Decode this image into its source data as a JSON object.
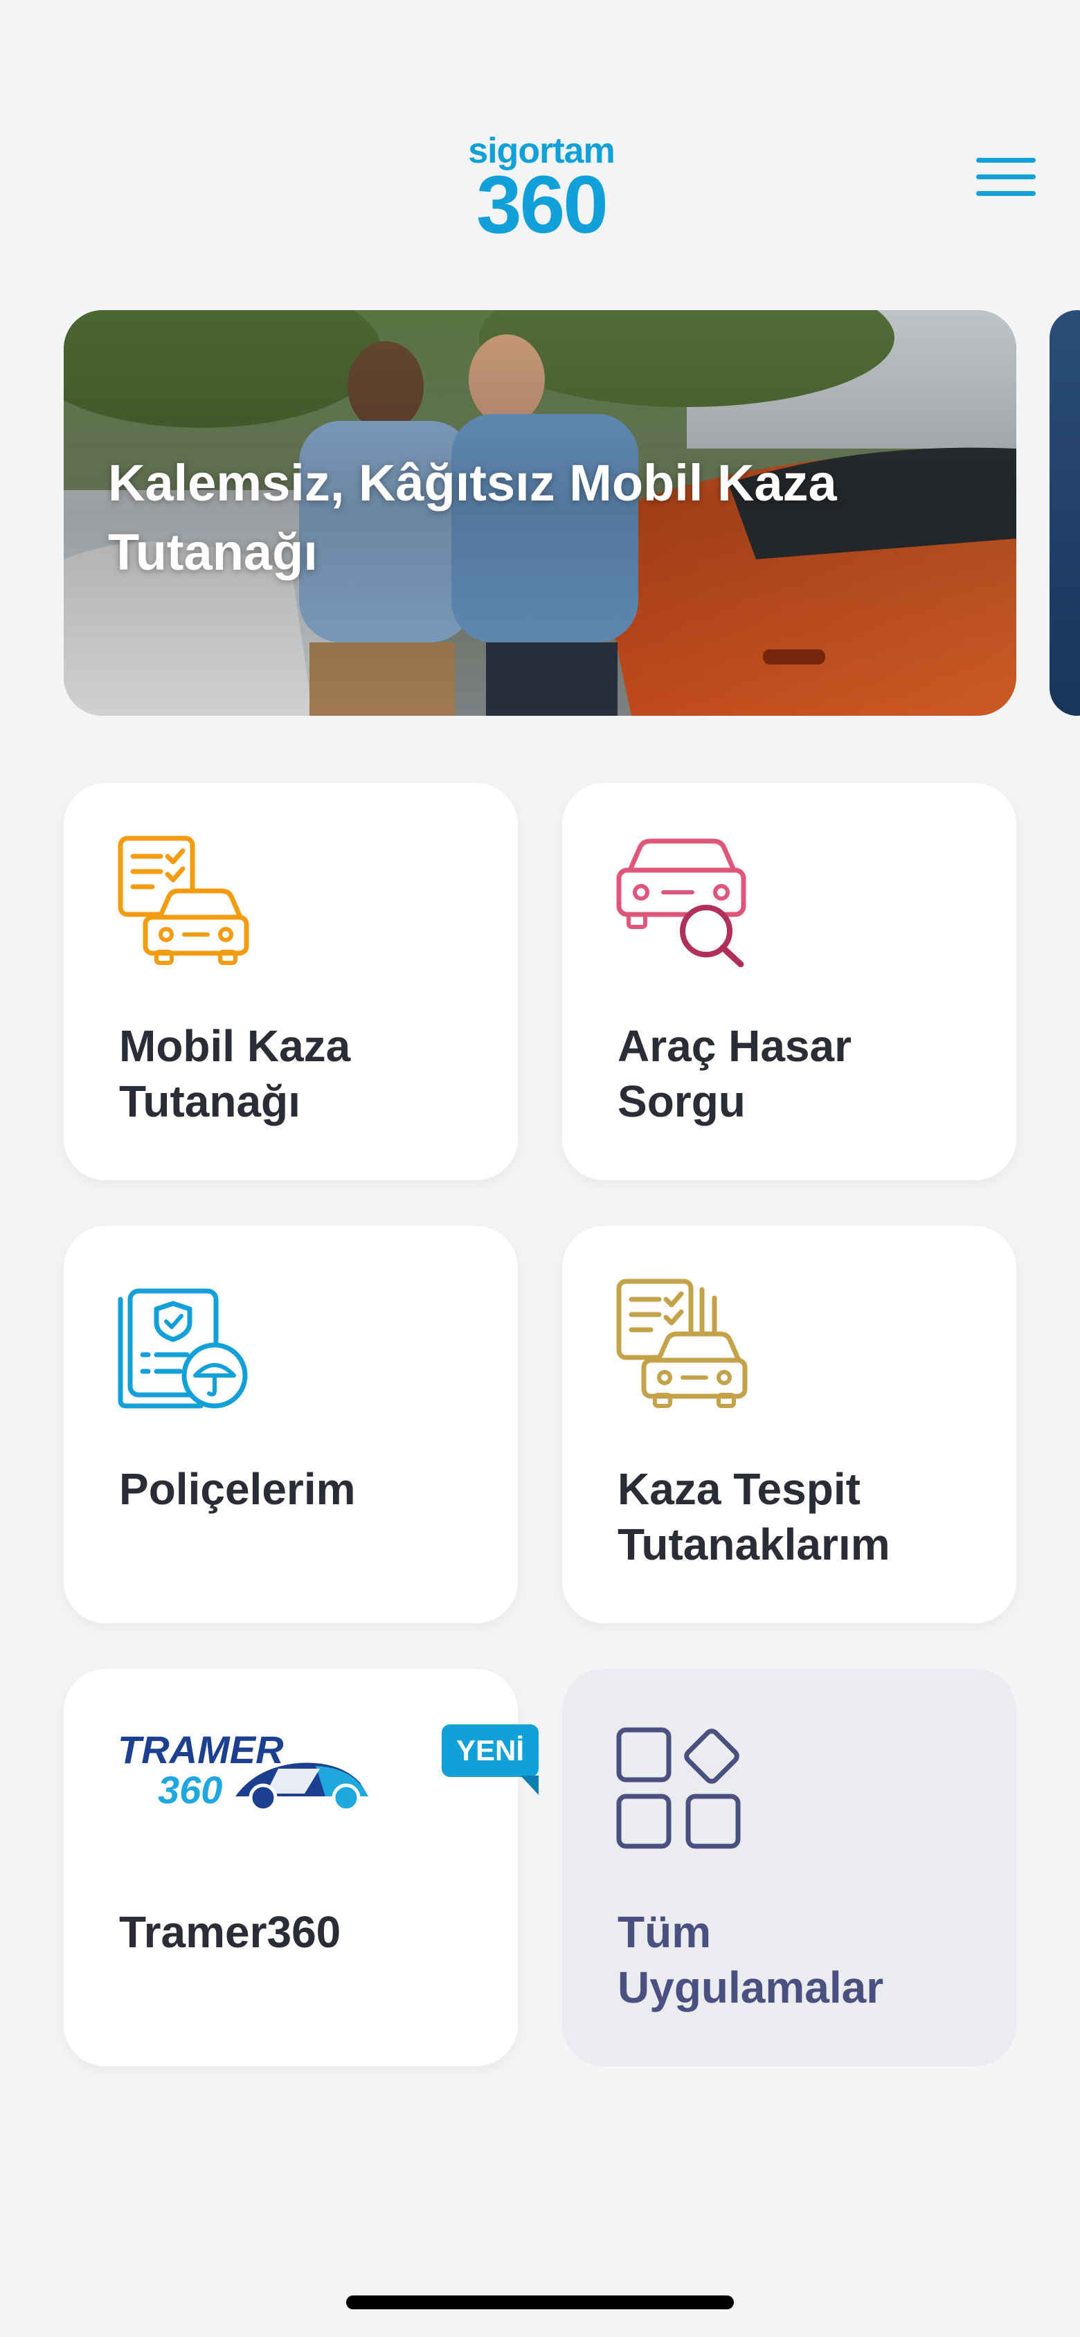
{
  "header": {
    "logo_small": "sigortam",
    "logo_big": "360",
    "menu_icon": "hamburger-menu-icon"
  },
  "banner": {
    "title": "Kalemsiz, Kâğıtsız Mobil  Kaza Tutanağı"
  },
  "cards": [
    {
      "label": "Mobil Kaza Tutanağı",
      "icon": "accident-report-icon",
      "color": "#f39c12"
    },
    {
      "label": "Araç Hasar Sorgu",
      "icon": "car-search-icon",
      "color": "#e0567a"
    },
    {
      "label": "Poliçelerim",
      "icon": "policy-document-icon",
      "color": "#12a0d8"
    },
    {
      "label": "Kaza Tespit Tutanaklarım",
      "icon": "accident-reports-list-icon",
      "color": "#c4a24a"
    },
    {
      "label": "Tramer360",
      "icon": "tramer360-logo",
      "badge": "YENİ",
      "logo_top": "TRAMER",
      "logo_bottom": "360"
    },
    {
      "label": "Tüm Uygulamalar",
      "icon": "all-apps-grid-icon",
      "color": "#4a5080"
    }
  ]
}
